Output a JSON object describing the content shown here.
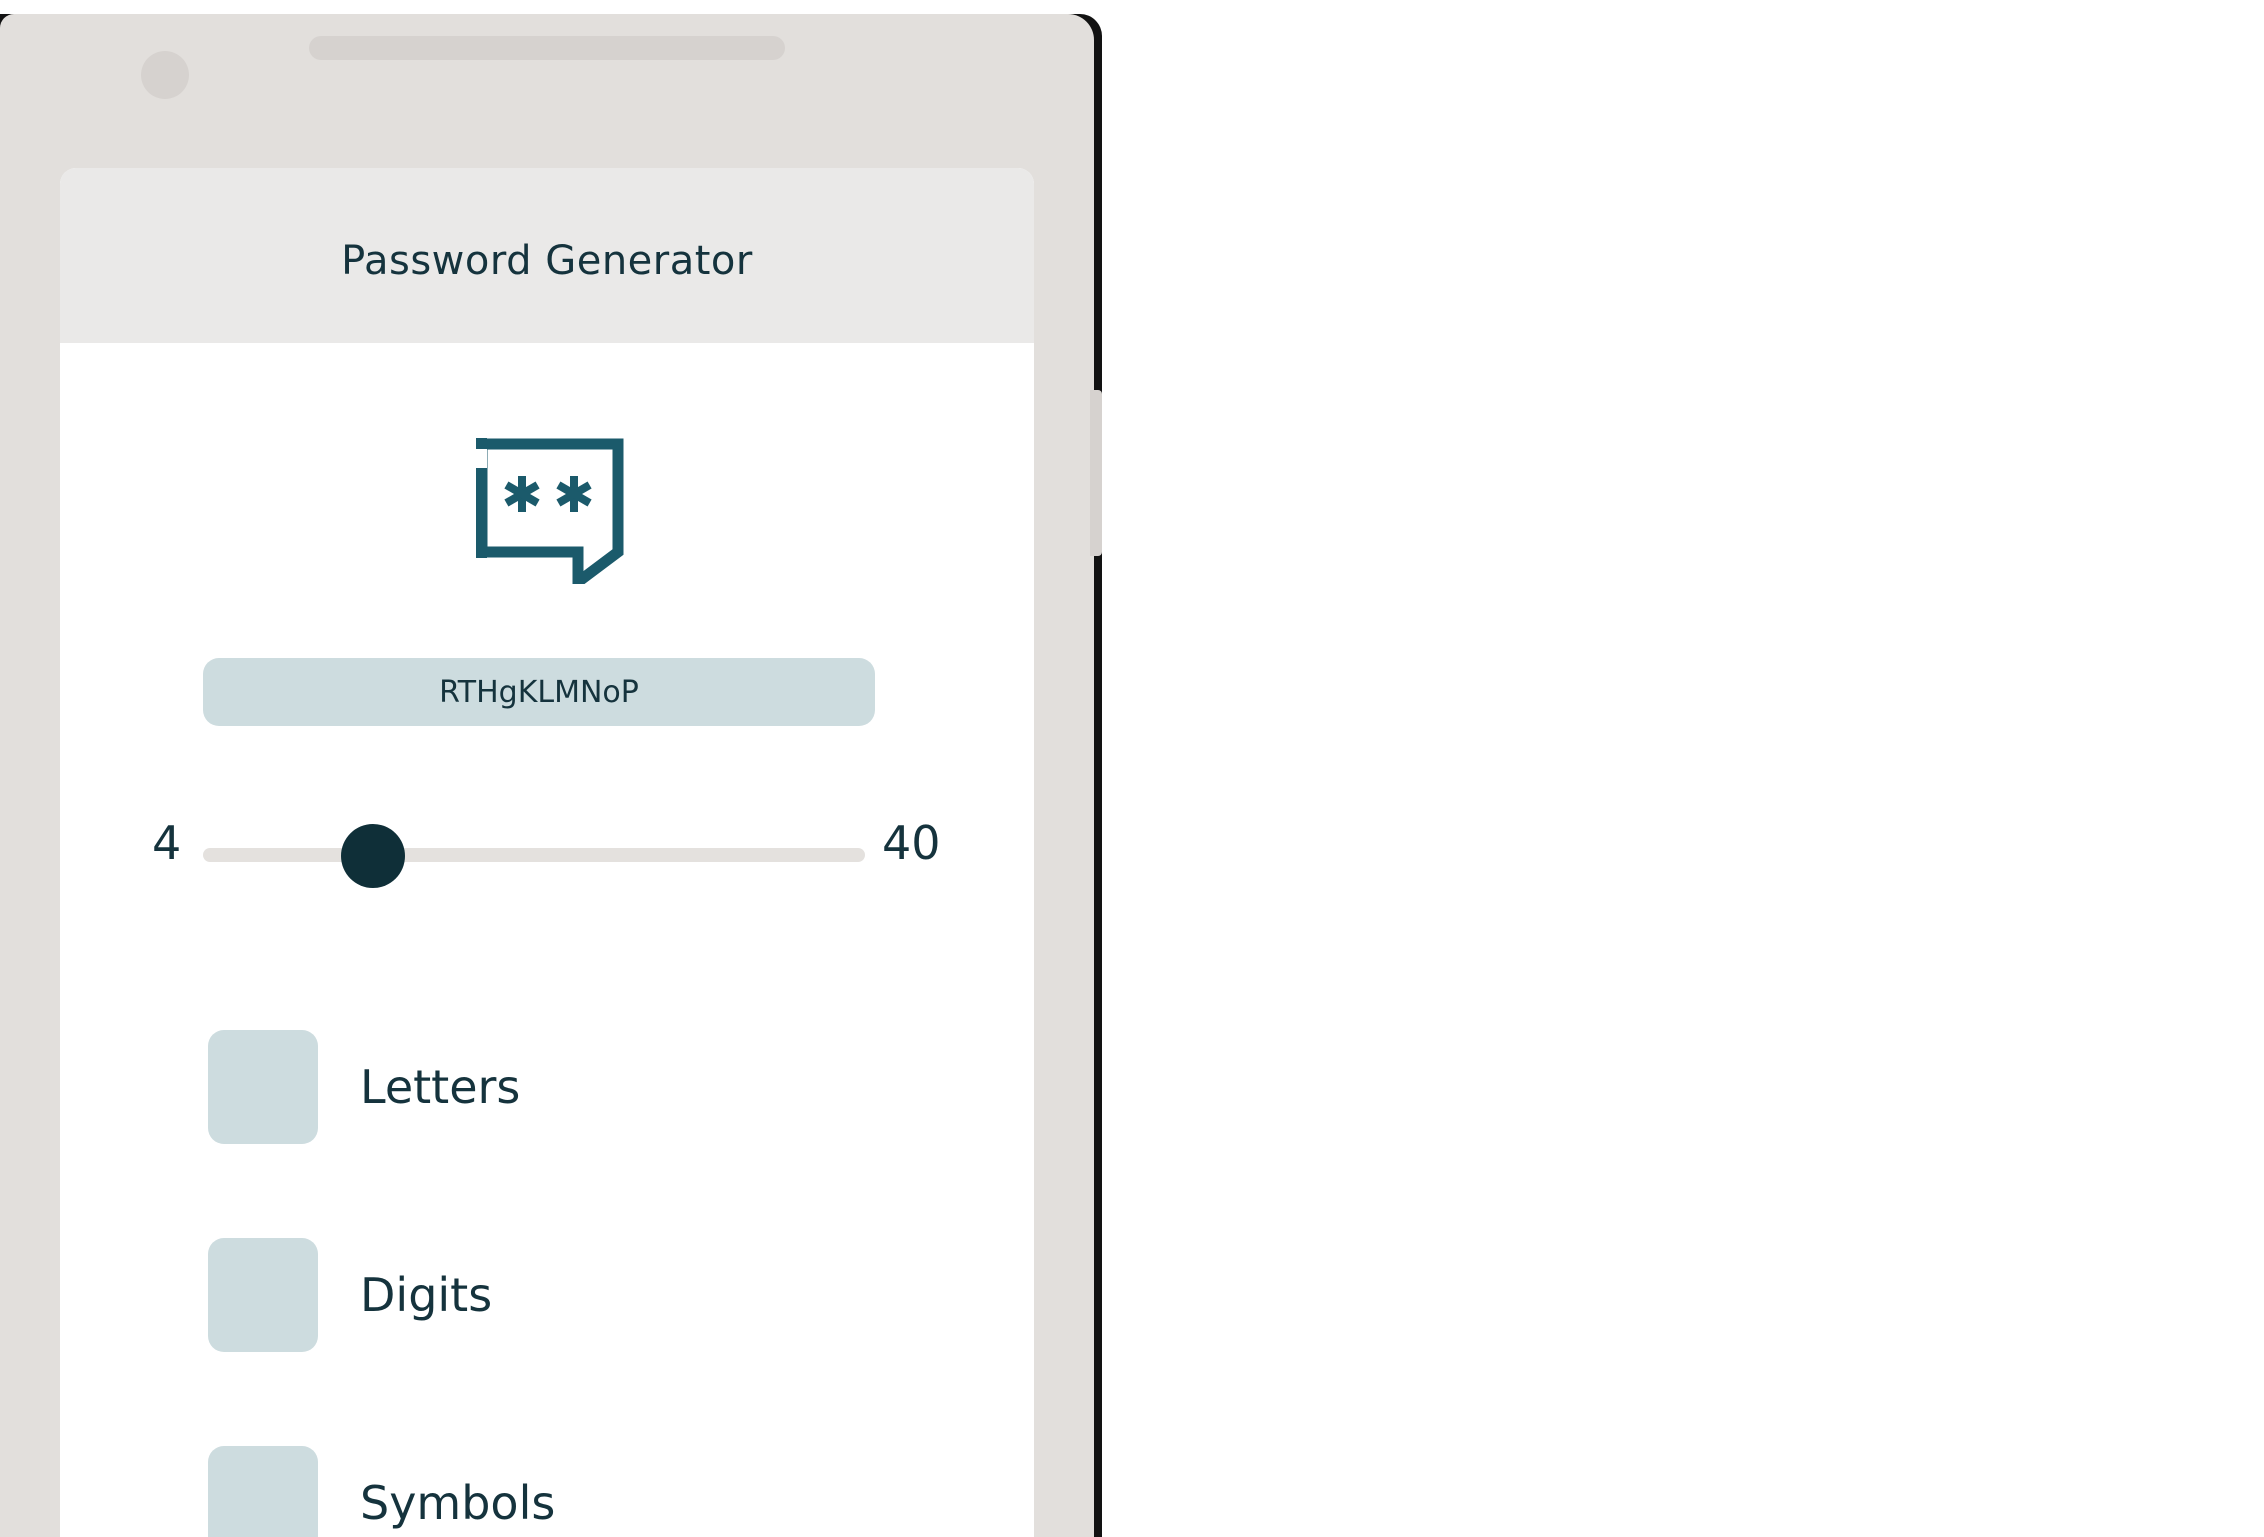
{
  "app": {
    "title": "Password Generator"
  },
  "logo": {
    "icon": "password-chat-icon",
    "color": "#1b5a6b"
  },
  "password": {
    "value": "RTHgKLMNoP"
  },
  "length_slider": {
    "min_label": "4",
    "max_label": "40",
    "min": 4,
    "max": 40,
    "value": 10
  },
  "options": [
    {
      "label": "Letters",
      "checked": false
    },
    {
      "label": "Digits",
      "checked": false
    },
    {
      "label": "Symbols",
      "checked": false
    }
  ],
  "colors": {
    "text": "#15333d",
    "field": "#cddcdf",
    "thumb": "#0f2f38",
    "app_bar": "#eae9e8",
    "device": "#e2dfdc"
  }
}
